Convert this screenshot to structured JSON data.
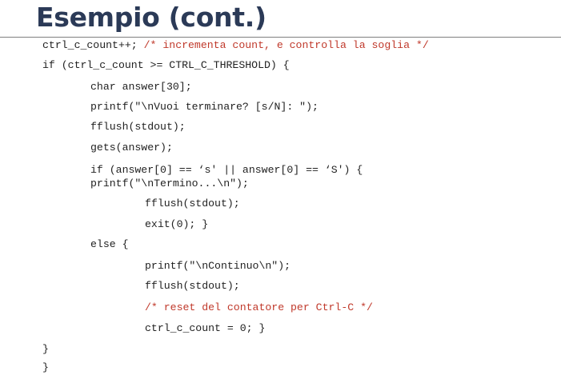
{
  "slide": {
    "title": "Esempio (cont.)"
  },
  "code": {
    "line1_code": "ctrl_c_count++; ",
    "line1_comment": "/* incrementa count, e controlla la soglia */",
    "line2": "if (ctrl_c_count >= CTRL_C_THRESHOLD) {",
    "line3": "char answer[30];",
    "line4": "printf(\"\\nVuoi terminare? [s/N]: \");",
    "line5": "fflush(stdout);",
    "line6": "gets(answer);",
    "line7": "if (answer[0] == ‘s' || answer[0] == ‘S') {",
    "line8": "printf(\"\\nTermino...\\n\");",
    "line9": "fflush(stdout);",
    "line10": "exit(0); }",
    "line11": "else {",
    "line12": "printf(\"\\nContinuo\\n\");",
    "line13": "fflush(stdout);",
    "line14_comment": "/* reset del contatore per Ctrl-C */",
    "line15": "ctrl_c_count = 0; }",
    "line16": "}",
    "line17": "}"
  },
  "colors": {
    "title": "#2b3a57",
    "code": "#222222",
    "comment": "#c0392b",
    "rule": "#7f7f7f"
  }
}
